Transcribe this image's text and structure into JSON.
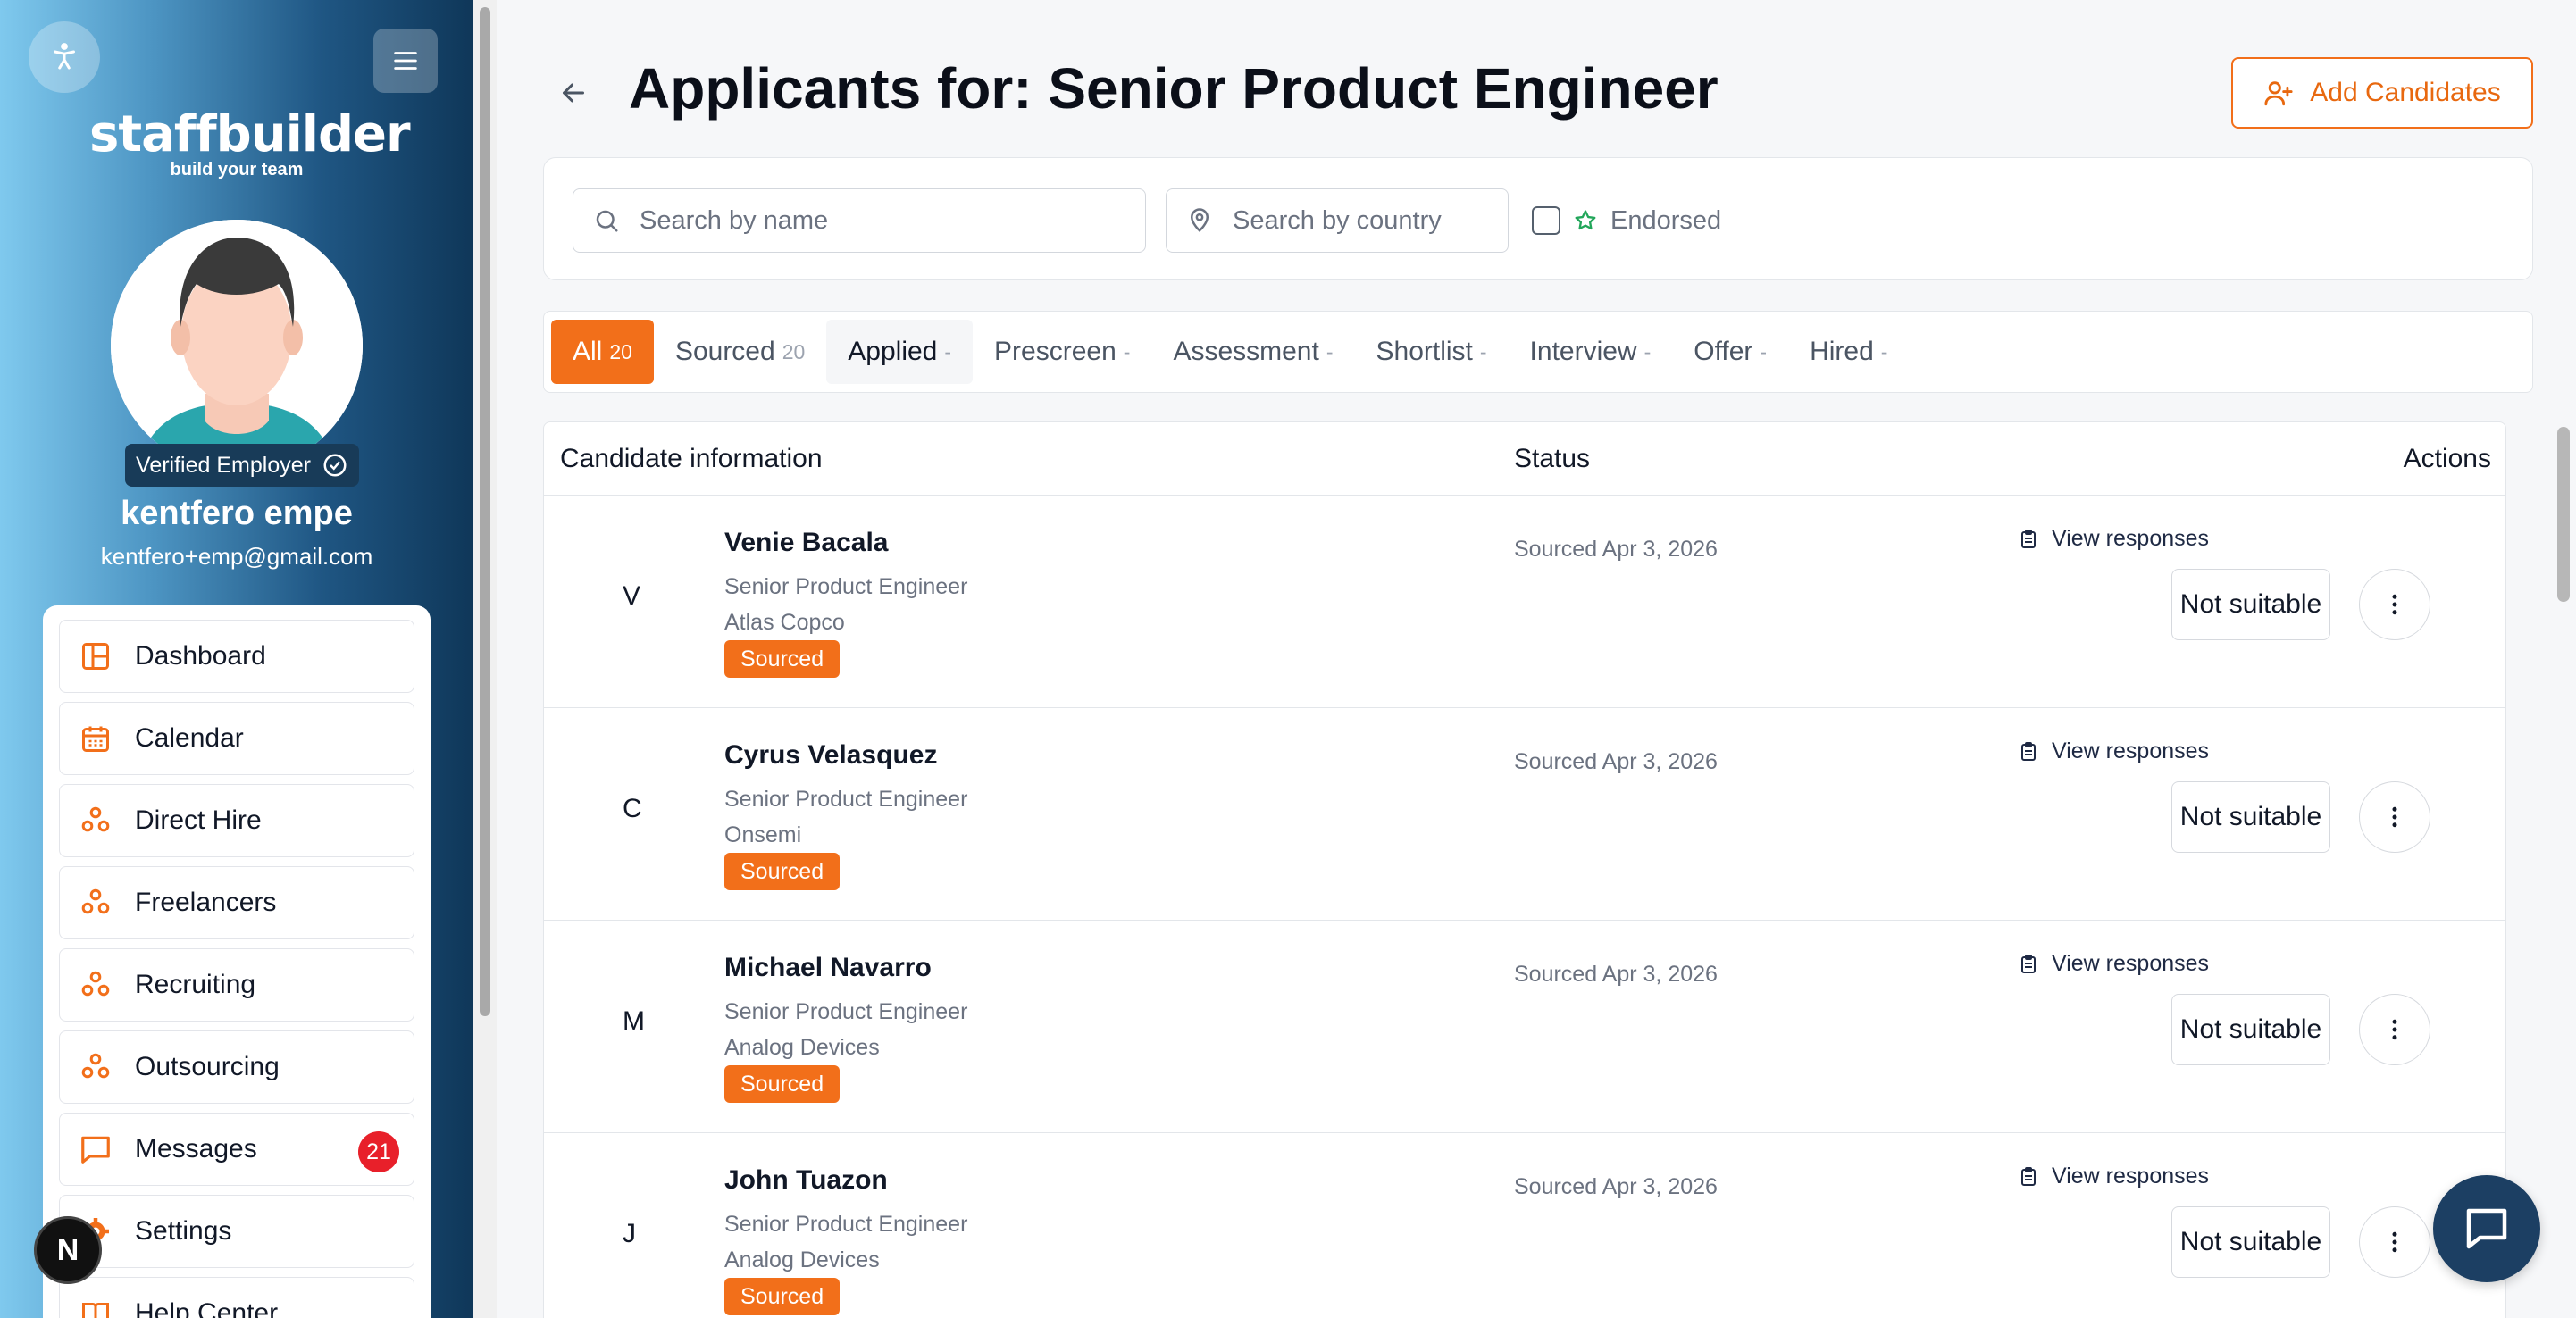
{
  "sidebar": {
    "logo_text": "staffbuilder",
    "logo_tagline": "build your team",
    "verified_label": "Verified Employer",
    "user_name": "kentfero empe",
    "user_email": "kentfero+emp@gmail.com",
    "nav": [
      {
        "label": "Dashboard",
        "icon": "dashboard-icon"
      },
      {
        "label": "Calendar",
        "icon": "calendar-icon"
      },
      {
        "label": "Direct Hire",
        "icon": "people-icon"
      },
      {
        "label": "Freelancers",
        "icon": "people-icon"
      },
      {
        "label": "Recruiting",
        "icon": "people-icon"
      },
      {
        "label": "Outsourcing",
        "icon": "people-icon"
      },
      {
        "label": "Messages",
        "icon": "chat-icon",
        "badge": "21"
      },
      {
        "label": "Settings",
        "icon": "gear-icon"
      },
      {
        "label": "Help Center",
        "icon": "book-icon"
      }
    ],
    "n_badge": "N"
  },
  "header": {
    "title": "Applicants for: Senior Product Engineer",
    "add_button": "Add Candidates"
  },
  "search": {
    "name_placeholder": "Search by name",
    "country_placeholder": "Search by country",
    "endorsed_label": "Endorsed"
  },
  "tabs": [
    {
      "label": "All",
      "count": "20"
    },
    {
      "label": "Sourced",
      "count": "20"
    },
    {
      "label": "Applied",
      "count": "-"
    },
    {
      "label": "Prescreen",
      "count": "-"
    },
    {
      "label": "Assessment",
      "count": "-"
    },
    {
      "label": "Shortlist",
      "count": "-"
    },
    {
      "label": "Interview",
      "count": "-"
    },
    {
      "label": "Offer",
      "count": "-"
    },
    {
      "label": "Hired",
      "count": "-"
    }
  ],
  "table": {
    "columns": {
      "candidate": "Candidate information",
      "status": "Status",
      "actions": "Actions"
    },
    "rows": [
      {
        "initial": "V",
        "name": "Venie Bacala",
        "title": "Senior Product Engineer",
        "company": "Atlas Copco",
        "pill": "Sourced",
        "status": "Sourced Apr 3, 2026",
        "view": "View responses",
        "not_suitable": "Not suitable"
      },
      {
        "initial": "C",
        "name": "Cyrus Velasquez",
        "title": "Senior Product Engineer",
        "company": "Onsemi",
        "pill": "Sourced",
        "status": "Sourced Apr 3, 2026",
        "view": "View responses",
        "not_suitable": "Not suitable"
      },
      {
        "initial": "M",
        "name": "Michael Navarro",
        "title": "Senior Product Engineer",
        "company": "Analog Devices",
        "pill": "Sourced",
        "status": "Sourced Apr 3, 2026",
        "view": "View responses",
        "not_suitable": "Not suitable"
      },
      {
        "initial": "J",
        "name": "John Tuazon",
        "title": "Senior Product Engineer",
        "company": "Analog Devices",
        "pill": "Sourced",
        "status": "Sourced Apr 3, 2026",
        "view": "View responses",
        "not_suitable": "Not suitable"
      }
    ]
  },
  "colors": {
    "accent": "#f26f1a",
    "sidebar_dark": "#0f3759",
    "badge_red": "#e8202a",
    "chat": "#1c3f63"
  }
}
